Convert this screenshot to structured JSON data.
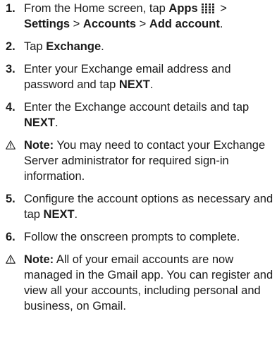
{
  "steps": {
    "s1": {
      "num": "1.",
      "pre": "From the Home screen, tap ",
      "apps": "Apps",
      "sep1": " > ",
      "settings": "Settings",
      "sep2": " > ",
      "accounts": "Accounts",
      "sep3": " > ",
      "add_account": "Add account",
      "end": "."
    },
    "s2": {
      "num": "2.",
      "pre": "Tap ",
      "exchange": "Exchange",
      "end": "."
    },
    "s3": {
      "num": "3.",
      "pre": "Enter your Exchange email address and password and tap ",
      "next": "NEXT",
      "end": "."
    },
    "s4": {
      "num": "4.",
      "pre": "Enter the Exchange account details and tap ",
      "next": "NEXT",
      "end": "."
    },
    "s5": {
      "num": "5.",
      "pre": "Configure the account options as necessary and tap ",
      "next": "NEXT",
      "end": "."
    },
    "s6": {
      "num": "6.",
      "text": "Follow the onscreen prompts to complete."
    }
  },
  "notes": {
    "n1": {
      "label": "Note:",
      "text": " You may need to contact your Exchange Server administrator for required sign-in information."
    },
    "n2": {
      "label": "Note:",
      "text": " All of your email accounts are now managed in the Gmail app. You can register and view all your accounts, including personal and business, on Gmail."
    }
  },
  "icons": {
    "apps": "apps-grid-icon",
    "warning": "warning-triangle-icon"
  }
}
